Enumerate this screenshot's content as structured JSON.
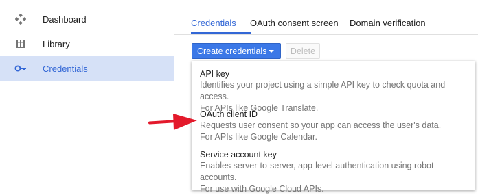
{
  "sidebar": {
    "items": [
      {
        "label": "Dashboard",
        "icon": "dashboard-icon",
        "active": false
      },
      {
        "label": "Library",
        "icon": "library-icon",
        "active": false
      },
      {
        "label": "Credentials",
        "icon": "key-icon",
        "active": true
      }
    ]
  },
  "tabs": [
    {
      "label": "Credentials",
      "active": true
    },
    {
      "label": "OAuth consent screen",
      "active": false
    },
    {
      "label": "Domain verification",
      "active": false
    }
  ],
  "toolbar": {
    "create_label": "Create credentials",
    "delete_label": "Delete"
  },
  "menu": {
    "items": [
      {
        "title": "API key",
        "desc1": "Identifies your project using a simple API key to check quota and access.",
        "desc2": "For APIs like Google Translate."
      },
      {
        "title": "OAuth client ID",
        "desc1": "Requests user consent so your app can access the user's data.",
        "desc2": "For APIs like Google Calendar."
      },
      {
        "title": "Service account key",
        "desc1": "Enables server-to-server, app-level authentication using robot accounts.",
        "desc2": "For use with Google Cloud APIs."
      }
    ]
  },
  "colors": {
    "accent": "#3367d6",
    "button": "#3b78e7",
    "active_bg": "#d6e1f7",
    "annotation_arrow": "#e3192b"
  }
}
